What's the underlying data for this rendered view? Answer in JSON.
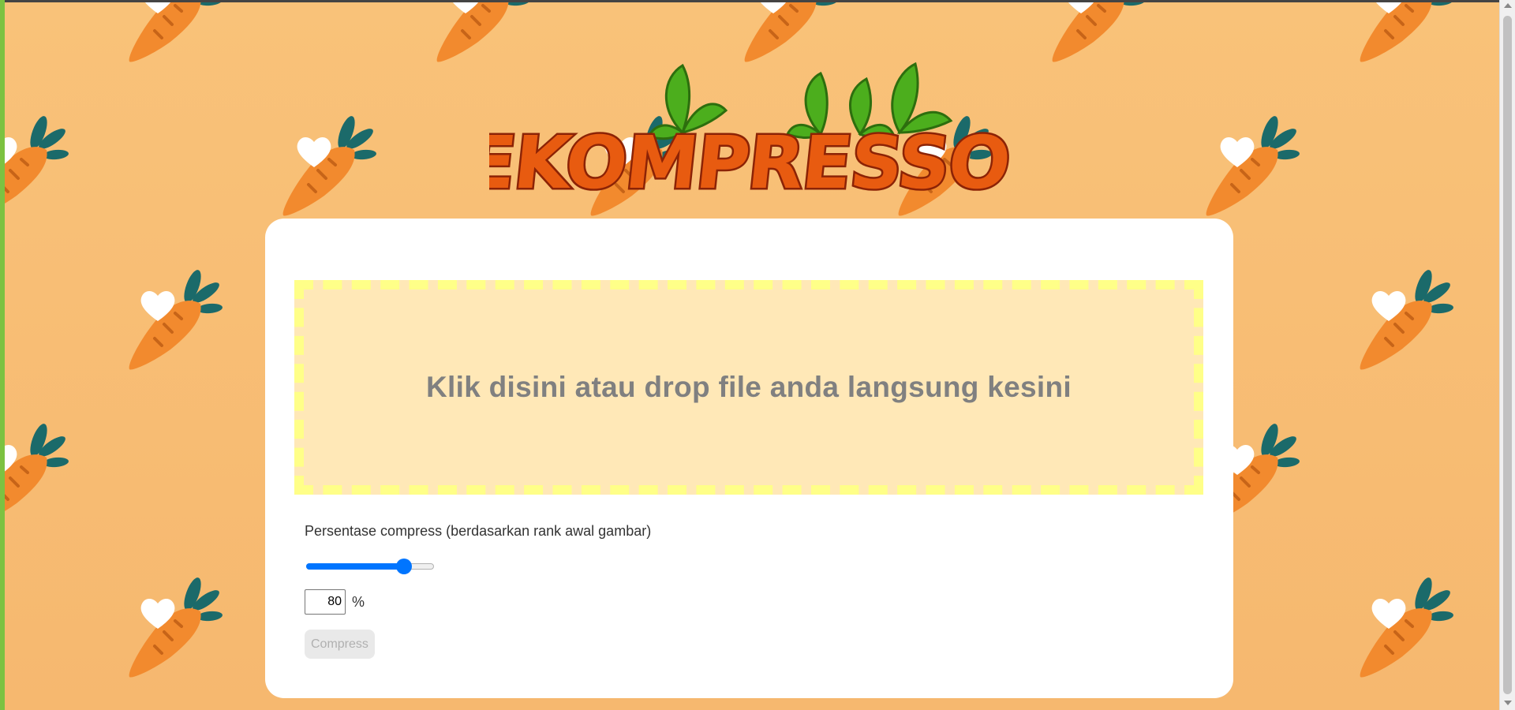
{
  "app": {
    "logo_text": "PEKOMPRESSOR",
    "background_pattern": [
      "carrot-icon",
      "heart-icon"
    ]
  },
  "dropzone": {
    "text": "Klik disini atau drop file anda langsung kesini"
  },
  "compression": {
    "label": "Persentase compress (berdasarkan rank awal gambar)",
    "slider_value_percent": 80,
    "input_value": "80",
    "unit": "%",
    "button_label": "Compress",
    "button_disabled": true
  },
  "colors": {
    "background": "#f7bb72",
    "dropzone_fill": "#ffe8b7",
    "dropzone_border": "#ffff88",
    "accent": "#0075ff",
    "carrot_orange": "#f28a2e",
    "carrot_leaves": "#1b6a6a"
  }
}
